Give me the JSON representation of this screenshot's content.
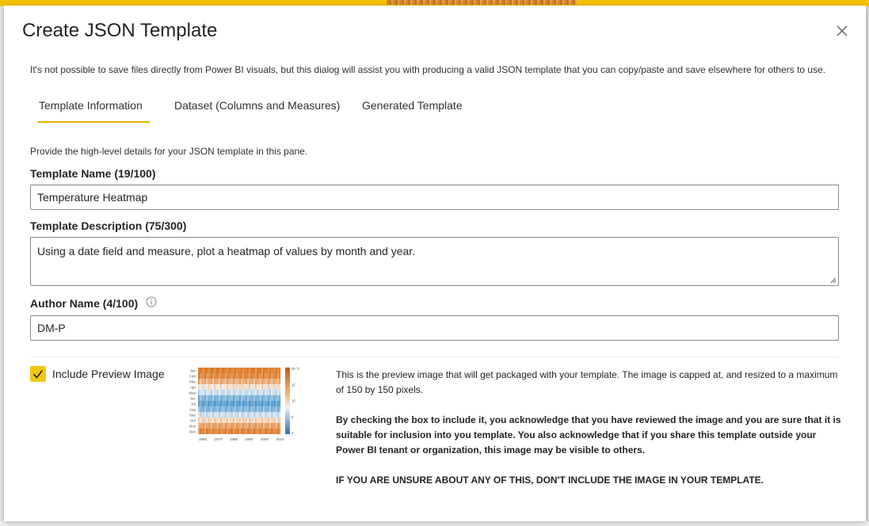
{
  "dialog": {
    "title": "Create JSON Template",
    "intro": "It's not possible to save files directly from Power BI visuals, but this dialog will assist you with producing a valid JSON template that you can copy/paste and save elsewhere for others to use."
  },
  "tabs": [
    {
      "label": "Template Information",
      "selected": true
    },
    {
      "label": "Dataset (Columns and Measures)",
      "selected": false
    },
    {
      "label": "Generated Template",
      "selected": false
    }
  ],
  "pane": {
    "description": "Provide the high-level details for your JSON template in this pane.",
    "template_name": {
      "label": "Template Name (19/100)",
      "value": "Temperature Heatmap"
    },
    "template_description": {
      "label": "Template Description (75/300)",
      "value": "Using a date field and measure, plot a heatmap of values by month and year."
    },
    "author_name": {
      "label": "Author Name (4/100)",
      "value": "DM-P"
    },
    "preview": {
      "checkbox_label": "Include Preview Image",
      "checked": true,
      "note": "This is the preview image that will get packaged with your template. The image is capped at, and resized to a maximum of 150 by 150 pixels.",
      "acknowledgement": "By checking the box to include it, you acknowledge that you have reviewed the image and you are sure that it is suitable for inclusion into you template. You also acknowledge that if you share this template outside your Power BI tenant or organization, this image may be visible to others.",
      "warning": "IF YOU ARE UNSURE ABOUT ANY OF THIS, DON'T INCLUDE THE IMAGE IN YOUR TEMPLATE.",
      "thumbnail": {
        "months": [
          "Jan",
          "Feb",
          "Mar",
          "Apr",
          "May",
          "Jun",
          "Jul",
          "Aug",
          "Sep",
          "Oct",
          "Nov",
          "Dec"
        ],
        "years": [
          "1960",
          "1970",
          "1980",
          "1990",
          "2000",
          "2010"
        ],
        "legend": [
          "20 °C",
          "15",
          "10",
          "5",
          "0"
        ]
      }
    }
  },
  "colors": {
    "accent": "#f2c811",
    "tab_underline": "#e8b400",
    "heat_hot": "#d4701f",
    "heat_cold": "#2e7dbd"
  }
}
